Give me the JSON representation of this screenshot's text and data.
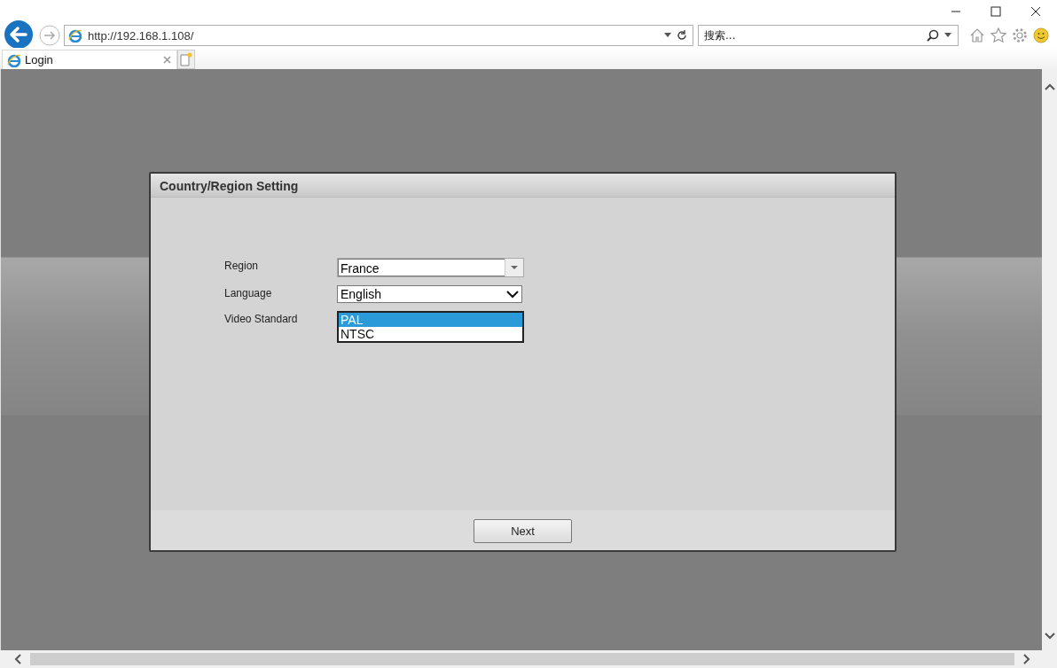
{
  "browser": {
    "address": "http://192.168.1.108/",
    "search": {
      "placeholder": "搜索..."
    },
    "tabs": [
      {
        "label": "Login",
        "selected": true
      }
    ]
  },
  "dialog": {
    "title": "Country/Region Setting",
    "fields": [
      {
        "kind": "combo",
        "label": "Region",
        "value": "France"
      },
      {
        "kind": "select",
        "label": "Language",
        "value": "English"
      },
      {
        "kind": "listbox",
        "label": "Video Standard",
        "options": [
          {
            "label": "PAL",
            "selected": true
          },
          {
            "label": "NTSC",
            "selected": false
          }
        ]
      }
    ],
    "buttons": [
      "Next"
    ]
  }
}
